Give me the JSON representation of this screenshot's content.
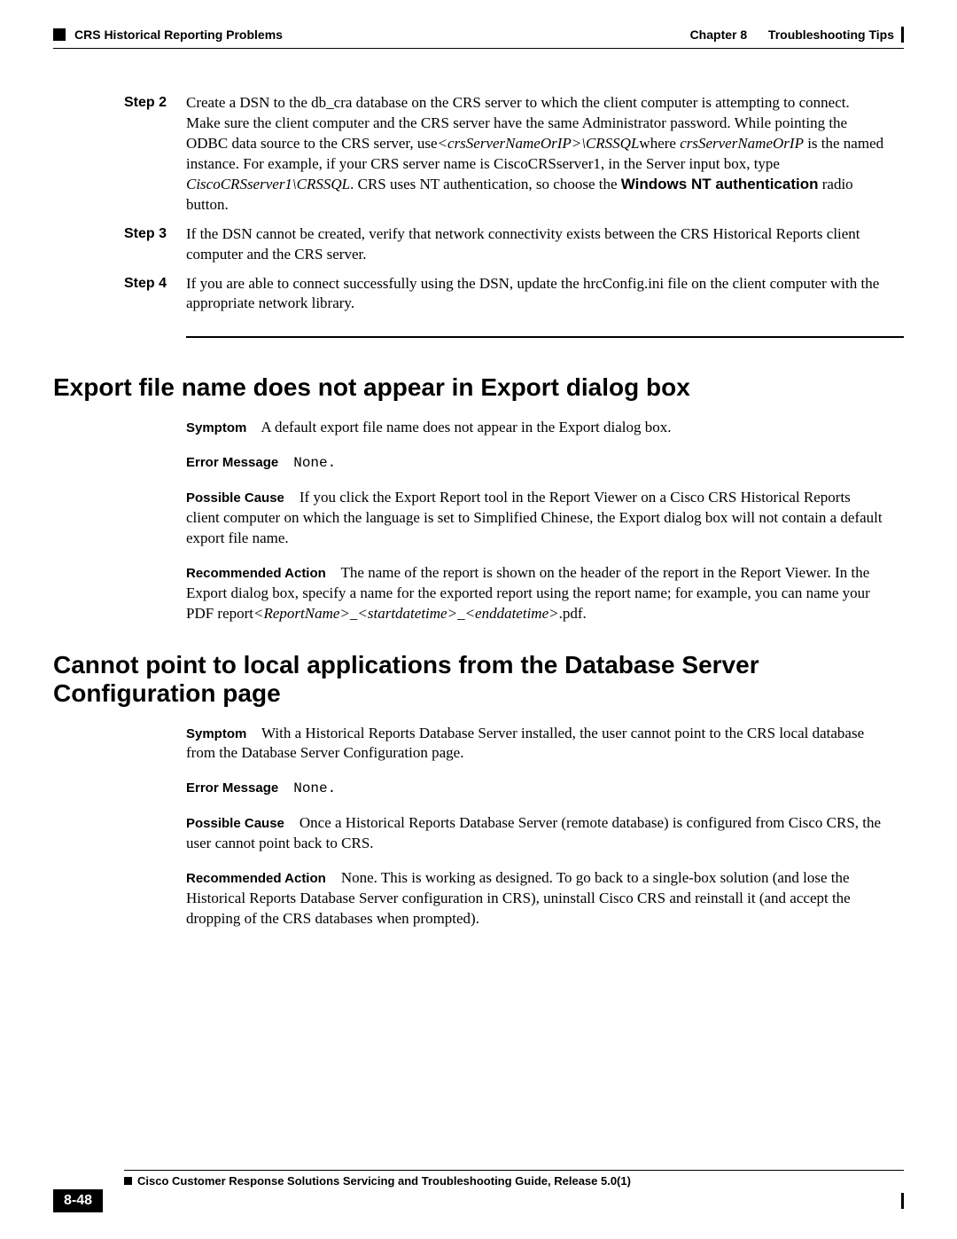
{
  "header": {
    "chapter_label": "Chapter 8",
    "chapter_title": "Troubleshooting Tips",
    "section_title": "CRS Historical Reporting Problems"
  },
  "steps": {
    "step2": {
      "label": "Step 2",
      "t1": "Create a DSN to the db_cra database on the CRS server to which the client computer is attempting to connect. Make sure the client computer and the CRS server have the same Administrator password. While pointing the ODBC data source to the CRS server, use",
      "i1": "<crsServerNameOrIP>\\CRSSQL",
      "t2": "where ",
      "i2": "crsServerNameOrIP",
      "t3": " is the named instance. For example, if your CRS server name is CiscoCRSserver1, in the Server input box, type ",
      "i3": "CiscoCRSserver1\\CRSSQL",
      "t4": ". CRS uses NT authentication, so choose the ",
      "b1": "Windows NT authentication",
      "t5": " radio button."
    },
    "step3": {
      "label": "Step 3",
      "text": "If the DSN cannot be created, verify that network connectivity exists between the CRS Historical Reports client computer and the CRS server."
    },
    "step4": {
      "label": "Step 4",
      "text": "If you are able to connect successfully using the DSN, update the hrcConfig.ini file on the client computer with the appropriate network library."
    }
  },
  "section1": {
    "heading": "Export file name does not appear in Export dialog box",
    "symptom_label": "Symptom",
    "symptom_text": "A default export file name does not appear in the Export dialog box.",
    "error_label": "Error Message",
    "error_text": "None.",
    "cause_label": "Possible Cause",
    "cause_text": "If you click the Export Report tool in the Report Viewer on a Cisco CRS Historical Reports client computer on which the language is set to Simplified Chinese, the Export dialog box will not contain a default export file name.",
    "action_label": "Recommended Action",
    "action_t1": "The name of the report is shown on the header of the report in the Report Viewer. In the Export dialog box, specify a name for the exported report using the report name; for example, you can name your PDF report",
    "action_i1": "<ReportName>_<startdatetime>_<enddatetime>",
    "action_t2": ".pdf."
  },
  "section2": {
    "heading": "Cannot point to local applications from the Database Server Configuration page",
    "symptom_label": "Symptom",
    "symptom_text": "With a Historical Reports Database Server installed, the user cannot point to the CRS local database from the Database Server Configuration page.",
    "error_label": "Error Message",
    "error_text": "None.",
    "cause_label": "Possible Cause",
    "cause_text": "Once a Historical Reports Database Server (remote database) is configured from Cisco CRS, the user cannot point back to CRS.",
    "action_label": "Recommended Action",
    "action_text": "None. This is working as designed. To go back to a single-box solution (and lose the Historical Reports Database Server configuration in CRS), uninstall Cisco CRS and reinstall it (and accept the dropping of the CRS databases when prompted)."
  },
  "footer": {
    "doc_title": "Cisco Customer Response Solutions Servicing and Troubleshooting Guide, Release 5.0(1)",
    "page_num": "8-48"
  }
}
